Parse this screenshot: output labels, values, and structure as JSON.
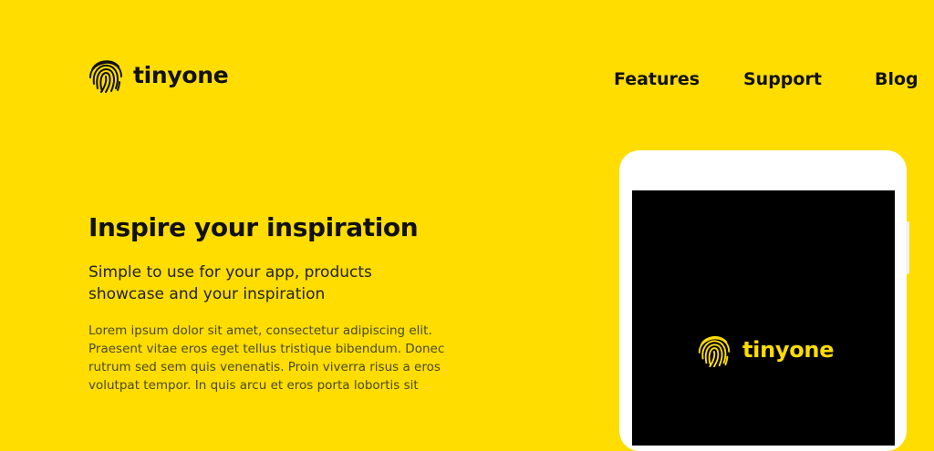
{
  "brand": {
    "name": "tinyone",
    "icon": "fingerprint-icon"
  },
  "nav": {
    "items": [
      "Features",
      "Support",
      "Blog"
    ]
  },
  "hero": {
    "title": "Inspire your inspiration",
    "subtitle": "Simple to use for your app, products showcase and your inspiration",
    "body": "Lorem ipsum dolor sit amet, consectetur adipiscing elit. Praesent vitae eros eget tellus tristique bibendum. Donec rutrum sed sem quis venenatis. Proin viverra risus a eros volutpat tempor. In quis arcu et eros porta lobortis sit"
  },
  "device": {
    "screen_brand": "tinyone",
    "screen_icon": "fingerprint-icon"
  },
  "colors": {
    "background": "#FFDD00",
    "text": "#111111",
    "screen": "#000000",
    "device": "#FFFFFF"
  }
}
